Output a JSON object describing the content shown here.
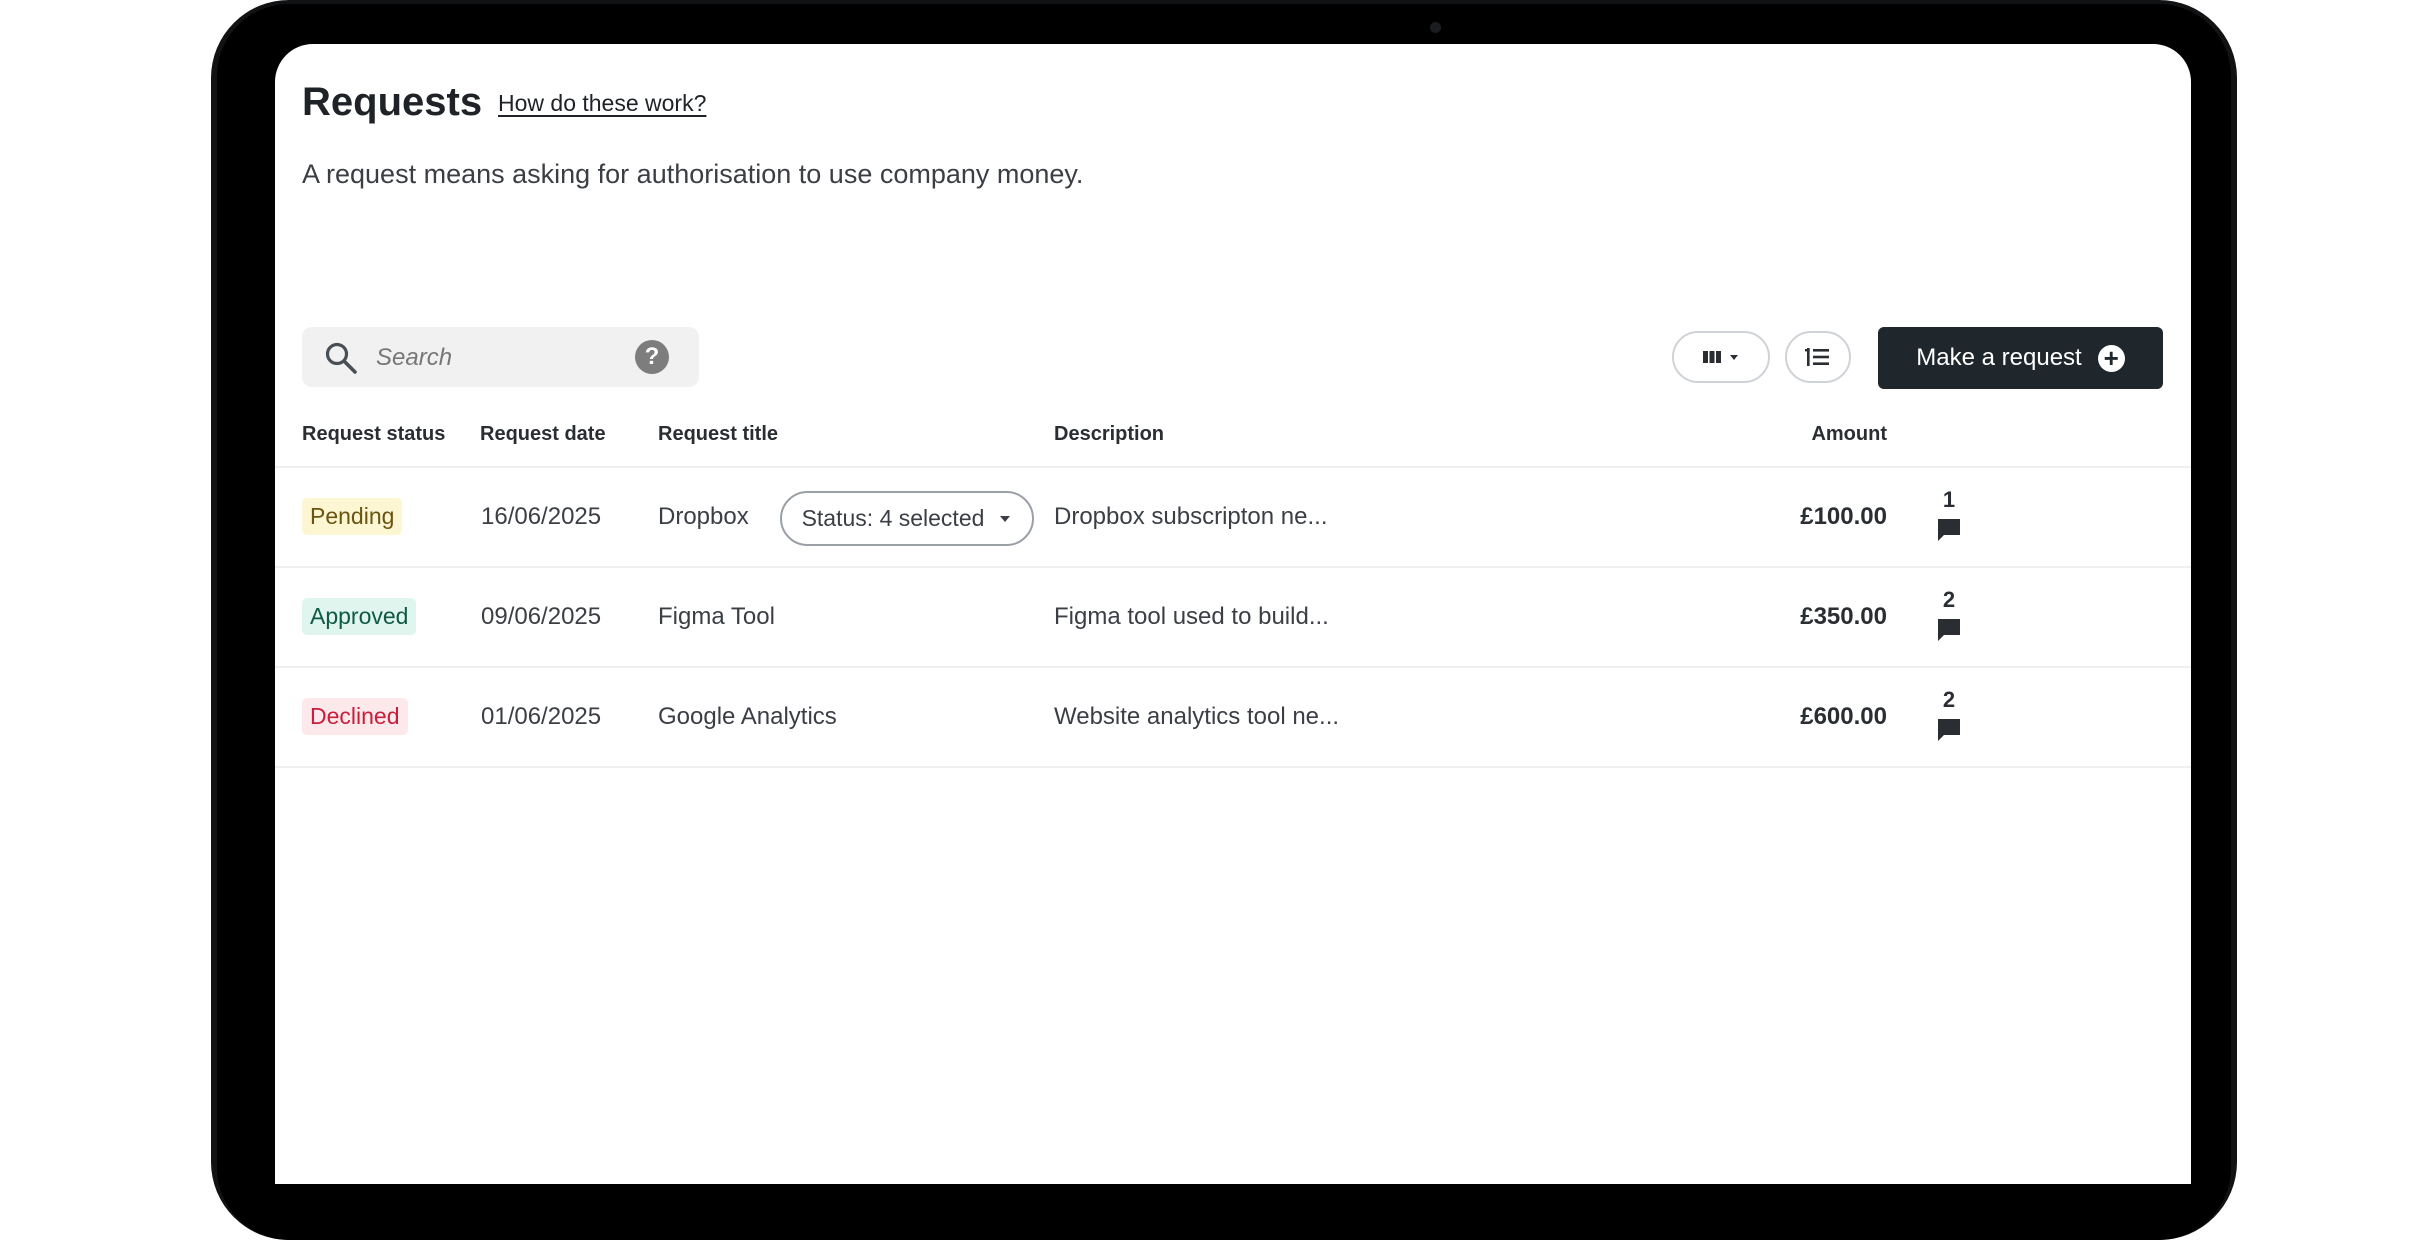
{
  "page": {
    "title": "Requests",
    "help_link": "How do these work?",
    "subtitle": "A request means asking for authorisation to use company money."
  },
  "toolbar": {
    "search_placeholder": "Search",
    "help_icon_glyph": "?",
    "make_request_label": "Make a request",
    "plus_glyph": "+"
  },
  "table": {
    "headers": {
      "status": "Request status",
      "date": "Request date",
      "title": "Request title",
      "description": "Description",
      "amount": "Amount"
    },
    "status_filter": "Status: 4 selected",
    "rows": [
      {
        "status": "Pending",
        "date": "16/06/2025",
        "title": "Dropbox",
        "description": "Dropbox subscripton ne...",
        "amount": "£100.00",
        "comments": "1"
      },
      {
        "status": "Approved",
        "date": "09/06/2025",
        "title": "Figma Tool",
        "description": "Figma tool used to build...",
        "amount": "£350.00",
        "comments": "2"
      },
      {
        "status": "Declined",
        "date": "01/06/2025",
        "title": "Google Analytics",
        "description": "Website analytics tool ne...",
        "amount": "£600.00",
        "comments": "2"
      }
    ]
  },
  "colors": {
    "primary_button": "#1f272d",
    "pending_bg": "#fdf6d3",
    "approved_bg": "#dff5ee",
    "declined_bg": "#fde8ec",
    "declined_text": "#c8203b"
  },
  "icons": [
    "search-icon",
    "help-icon",
    "columns-icon",
    "chevron-down-icon",
    "sort-icon",
    "plus-icon",
    "comment-icon"
  ]
}
